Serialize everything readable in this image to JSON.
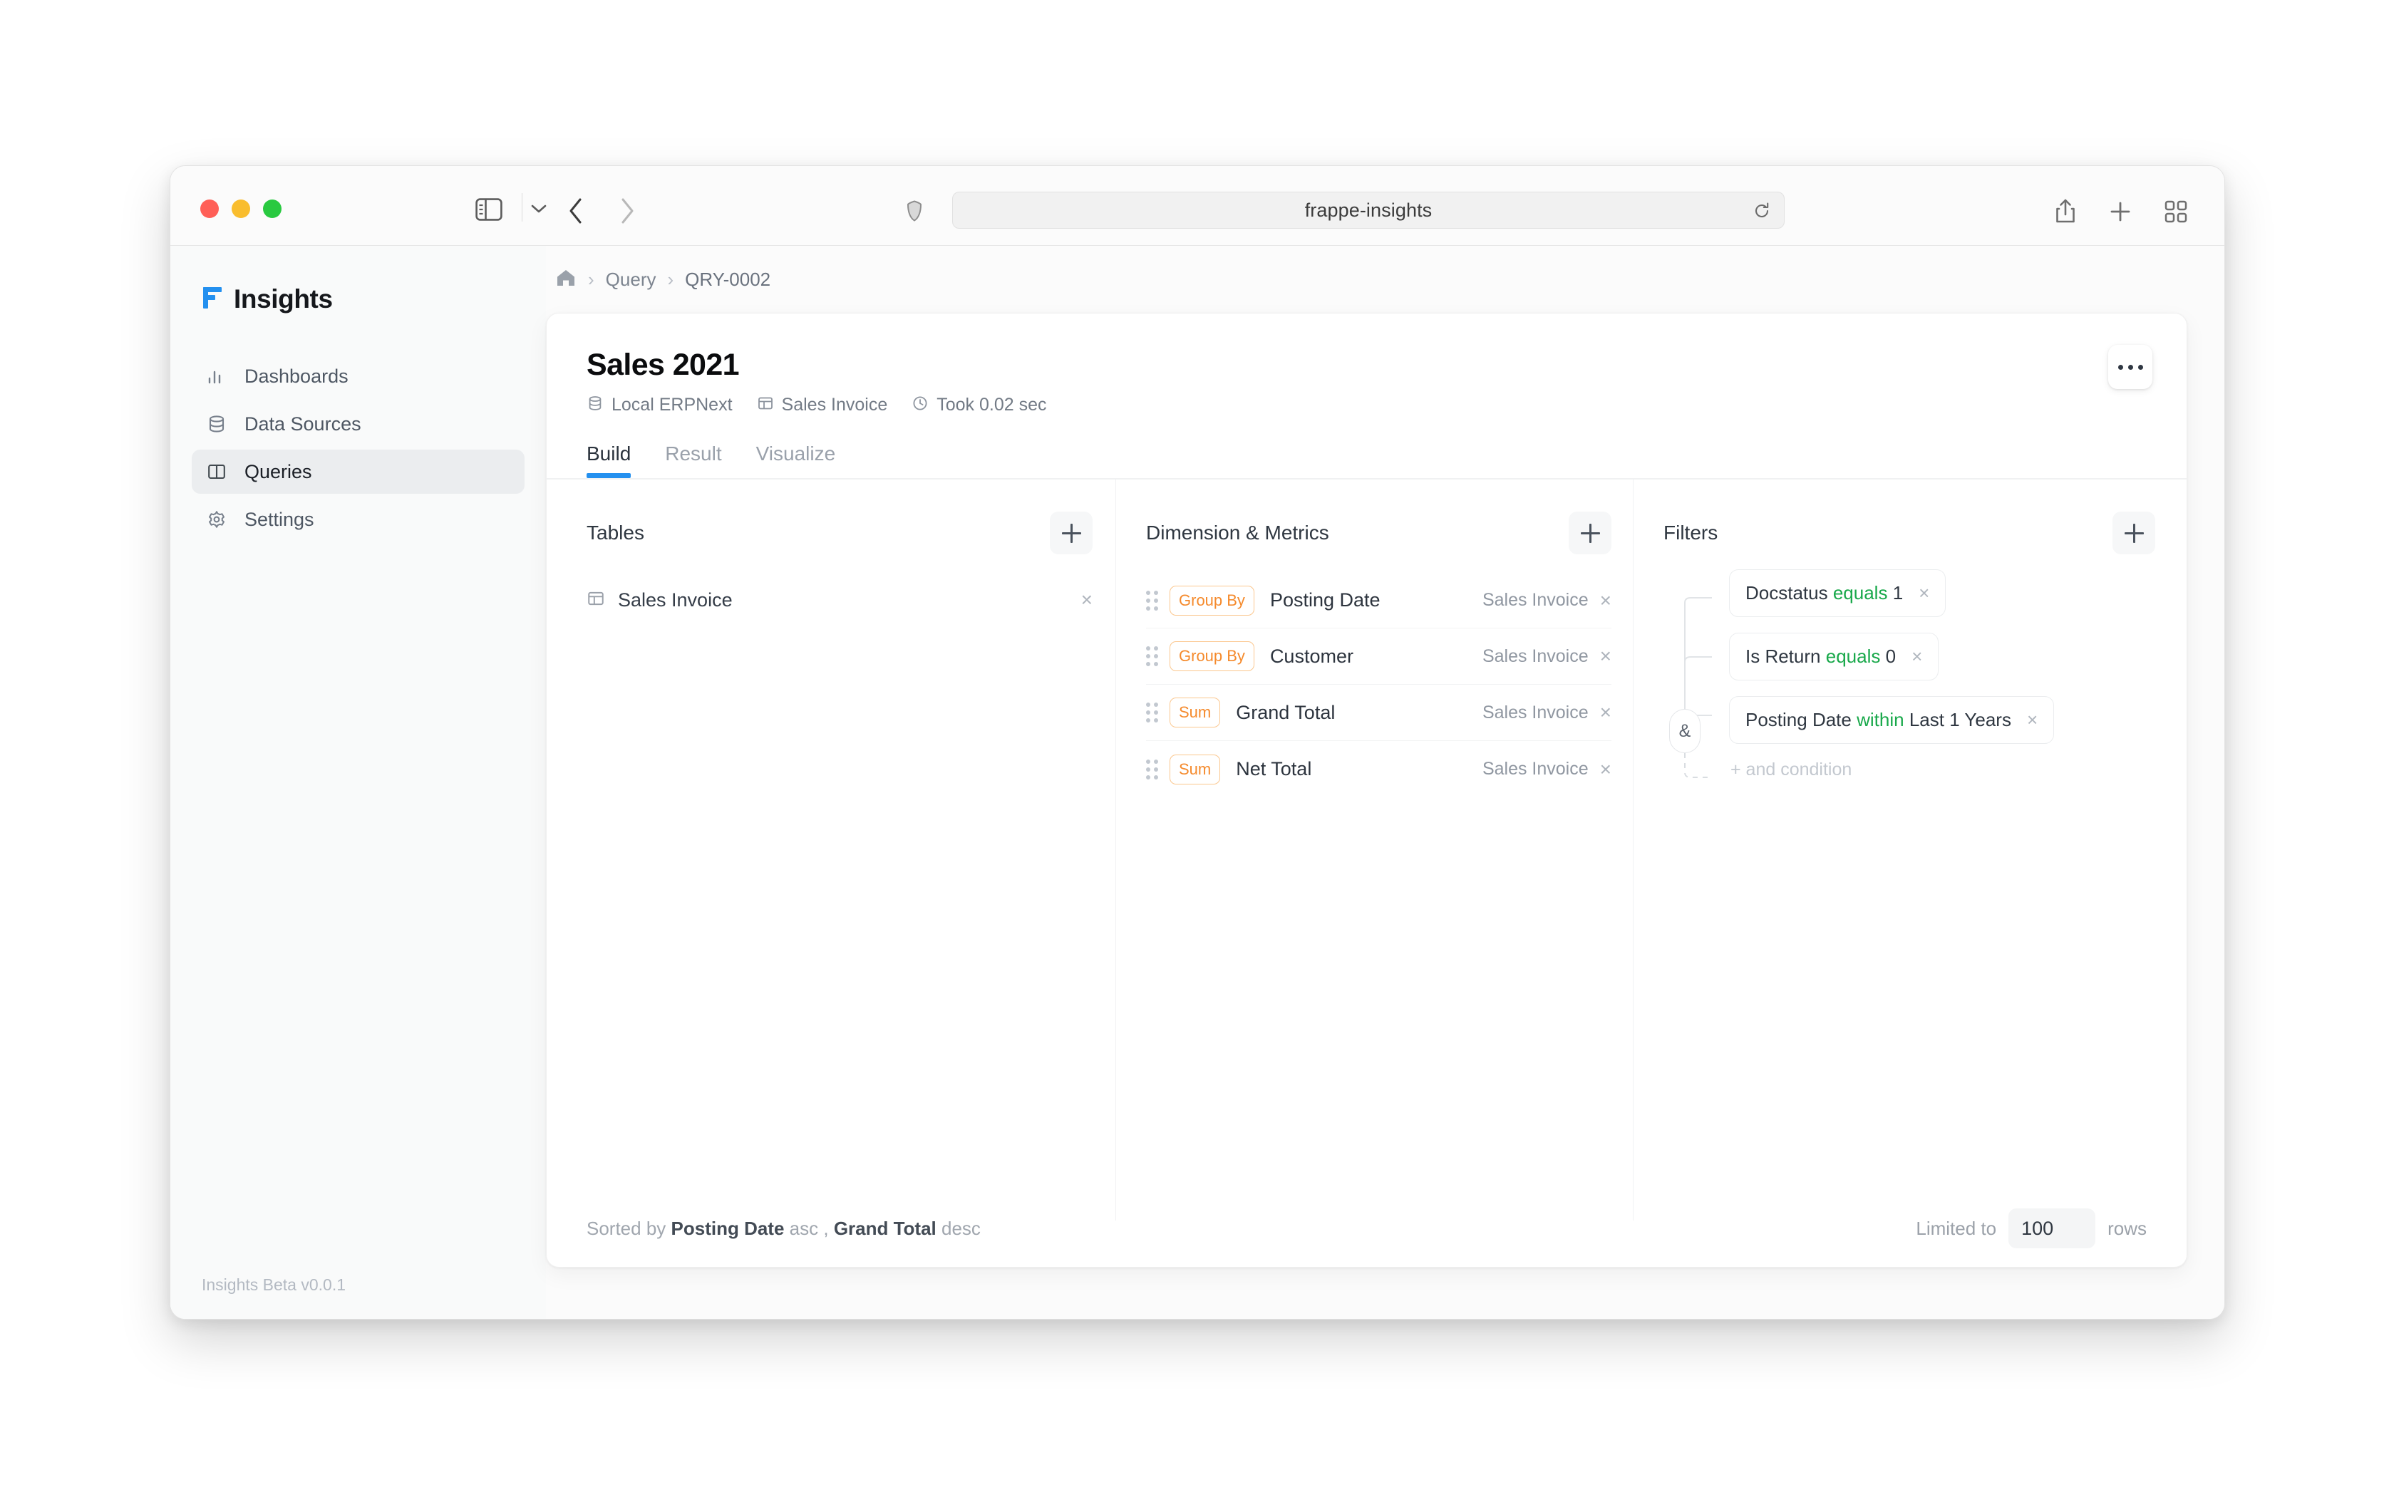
{
  "browser": {
    "url_text": "frappe-insights",
    "window_controls": [
      "close",
      "minimize",
      "maximize"
    ],
    "icons": {
      "sidebar_toggle": "sidebar-toggle-icon",
      "chevron_down": "chevron-down-icon",
      "back": "back-arrow-icon",
      "forward": "forward-arrow-icon",
      "shield": "shield-icon",
      "reload": "reload-icon",
      "share": "share-icon",
      "new_tab": "plus-icon",
      "tab_overview": "tab-overview-icon"
    }
  },
  "sidebar": {
    "brand": "Insights",
    "items": [
      {
        "label": "Dashboards",
        "icon": "bar-chart-icon",
        "active": false
      },
      {
        "label": "Data Sources",
        "icon": "database-icon",
        "active": false
      },
      {
        "label": "Queries",
        "icon": "columns-icon",
        "active": true
      },
      {
        "label": "Settings",
        "icon": "gear-icon",
        "active": false
      }
    ],
    "footer": "Insights Beta v0.0.1"
  },
  "breadcrumb": {
    "home_icon": "home-icon",
    "sep": "›",
    "items": [
      "Query",
      "QRY-0002"
    ]
  },
  "query": {
    "title": "Sales 2021",
    "meta": [
      {
        "label": "Local ERPNext",
        "icon": "database-icon"
      },
      {
        "label": "Sales Invoice",
        "icon": "table-icon"
      },
      {
        "label": "Took 0.02 sec",
        "icon": "clock-icon"
      }
    ],
    "kebab_label": "…"
  },
  "tabs": [
    {
      "label": "Build",
      "active": true
    },
    {
      "label": "Result",
      "active": false
    },
    {
      "label": "Visualize",
      "active": false
    }
  ],
  "tables_panel": {
    "title": "Tables",
    "add_label": "+",
    "rows": [
      {
        "label": "Sales Invoice",
        "icon": "table-icon",
        "remove": "×"
      }
    ]
  },
  "dimensions_panel": {
    "title": "Dimension & Metrics",
    "add_label": "+",
    "rows": [
      {
        "agg": "Group By",
        "label": "Posting Date",
        "source": "Sales Invoice",
        "remove": "×"
      },
      {
        "agg": "Group By",
        "label": "Customer",
        "source": "Sales Invoice",
        "remove": "×"
      },
      {
        "agg": "Sum",
        "label": "Grand Total",
        "source": "Sales Invoice",
        "remove": "×"
      },
      {
        "agg": "Sum",
        "label": "Net Total",
        "source": "Sales Invoice",
        "remove": "×"
      }
    ]
  },
  "filters_panel": {
    "title": "Filters",
    "add_label": "+",
    "operator_node": "&",
    "rows": [
      {
        "field": "Docstatus",
        "operator": "equals",
        "value": "1",
        "remove": "×"
      },
      {
        "field": "Is Return",
        "operator": "equals",
        "value": "0",
        "remove": "×"
      },
      {
        "field": "Posting Date",
        "operator": "within",
        "value": "Last 1 Years",
        "remove": "×"
      }
    ],
    "add_condition": "+ and condition"
  },
  "footer": {
    "sort_prefix": "Sorted by ",
    "sort_field_1": "Posting Date",
    "sort_dir_1": " asc ",
    "sort_comma": ", ",
    "sort_field_2": "Grand Total",
    "sort_dir_2": " desc",
    "limit_prefix": "Limited to",
    "limit_value": "100",
    "limit_suffix": "rows"
  },
  "colors": {
    "accent": "#2490ef",
    "badge": "#f58a2c",
    "operator": "#18a84a",
    "brand_blue": "#2490ef"
  }
}
